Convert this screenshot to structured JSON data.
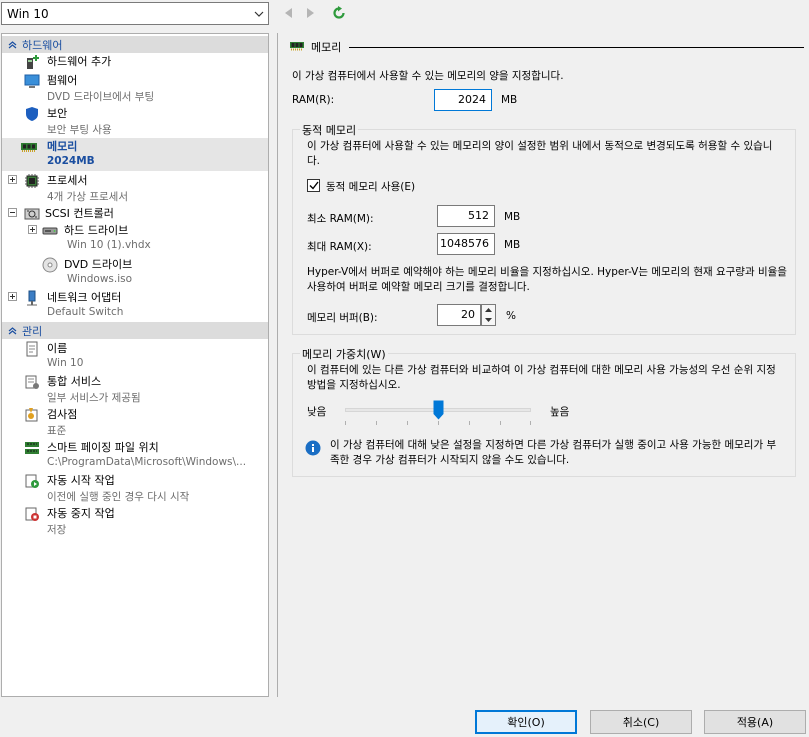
{
  "vm_selector": {
    "value": "Win 10"
  },
  "icons": {
    "back": "back-arrow-icon",
    "forward": "forward-arrow-icon",
    "refresh": "refresh-icon"
  },
  "tree": {
    "hardware_category": "하드웨어",
    "management_category": "관리",
    "hardware": [
      {
        "name": "하드웨어 추가",
        "sub": ""
      },
      {
        "name": "펌웨어",
        "sub": "DVD 드라이브에서 부팅"
      },
      {
        "name": "보안",
        "sub": "보안 부팅 사용"
      },
      {
        "name": "메모리",
        "sub": "2024MB"
      },
      {
        "name": "프로세서",
        "sub": "4개 가상 프로세서"
      },
      {
        "name": "SCSI 컨트롤러",
        "sub": ""
      },
      {
        "name": "하드 드라이브",
        "sub": "Win 10 (1).vhdx"
      },
      {
        "name": "DVD 드라이브",
        "sub": "Windows.iso"
      },
      {
        "name": "네트워크 어댑터",
        "sub": "Default Switch"
      }
    ],
    "management": [
      {
        "name": "이름",
        "sub": "Win 10"
      },
      {
        "name": "통합 서비스",
        "sub": "일부 서비스가 제공됨"
      },
      {
        "name": "검사점",
        "sub": "표준"
      },
      {
        "name": "스마트 페이징 파일 위치",
        "sub": "C:\\ProgramData\\Microsoft\\Windows\\..."
      },
      {
        "name": "자동 시작 작업",
        "sub": "이전에 실행 중인 경우 다시 시작"
      },
      {
        "name": "자동 중지 작업",
        "sub": "저장"
      }
    ]
  },
  "memory": {
    "section_title": "메모리",
    "description": "이 가상 컴퓨터에서 사용할 수 있는 메모리의 양을 지정합니다.",
    "ram_label": "RAM(R):",
    "ram_value": "2024",
    "unit": "MB",
    "dynamic": {
      "title": "동적 메모리",
      "description": "이 가상 컴퓨터에 사용할 수 있는 메모리의 양이 설정한 범위 내에서 동적으로 변경되도록 허용할 수 있습니다.",
      "enable_label": "동적 메모리 사용(E)",
      "enabled": true,
      "min_label": "최소 RAM(M):",
      "min_value": "512",
      "max_label": "최대 RAM(X):",
      "max_value": "1048576",
      "buffer_description": "Hyper-V에서 버퍼로 예약해야 하는 메모리 비율을 지정하십시오. Hyper-V는 메모리의 현재 요구량과 비율을 사용하여 버퍼로 예약할 메모리 크기를 결정합니다.",
      "buffer_label": "메모리 버퍼(B):",
      "buffer_value": "20",
      "buffer_unit": "%"
    },
    "weight": {
      "title": "메모리 가중치(W)",
      "description": "이 컴퓨터에 있는 다른 가상 컴퓨터와 비교하여 이 가상 컴퓨터에 대한 메모리 사용 가능성의 우선 순위 지정 방법을 지정하십시오.",
      "low_label": "낮음",
      "high_label": "높음",
      "slider_fraction": 0.5,
      "info_text": "이 가상 컴퓨터에 대해 낮은 설정을 지정하면 다른 가상 컴퓨터가 실행 중이고 사용 가능한 메모리가 부족한 경우 가상 컴퓨터가 시작되지 않을 수도 있습니다."
    }
  },
  "buttons": {
    "ok": "확인(O)",
    "cancel": "취소(C)",
    "apply": "적용(A)"
  },
  "colors": {
    "accent": "#0078d7",
    "category_text": "#1a4ea0",
    "info": "#1a6ec4"
  }
}
